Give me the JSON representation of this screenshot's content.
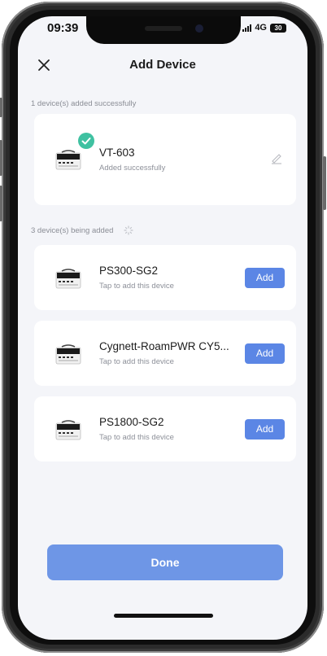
{
  "status_bar": {
    "time": "09:39",
    "network": "4G",
    "battery": "30"
  },
  "header": {
    "title": "Add Device"
  },
  "added_section": {
    "label": "1 device(s) added successfully",
    "devices": [
      {
        "name": "VT-603",
        "status": "Added successfully"
      }
    ]
  },
  "pending_section": {
    "label": "3 device(s) being added",
    "devices": [
      {
        "name": "PS300-SG2",
        "hint": "Tap to add this device",
        "button": "Add"
      },
      {
        "name": "Cygnett-RoamPWR CY5...",
        "hint": "Tap to add this device",
        "button": "Add"
      },
      {
        "name": "PS1800-SG2",
        "hint": "Tap to add this device",
        "button": "Add"
      }
    ]
  },
  "footer": {
    "done_label": "Done"
  },
  "colors": {
    "accent": "#5b86e5",
    "success": "#3fc1a1",
    "background": "#f4f5f9"
  }
}
